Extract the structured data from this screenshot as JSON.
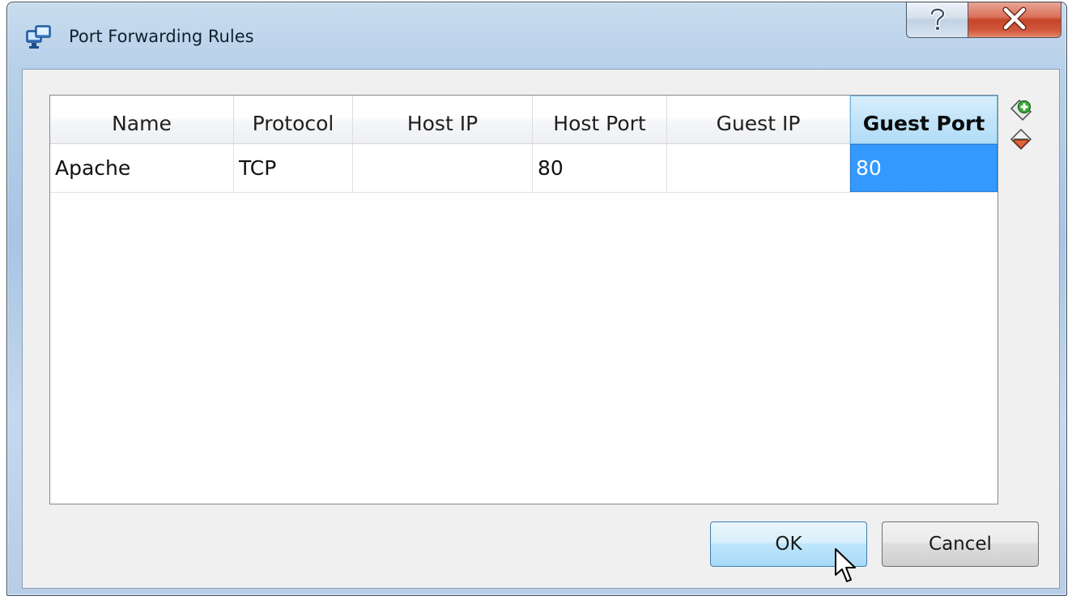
{
  "window": {
    "title": "Port Forwarding Rules",
    "help_glyph": "?",
    "close_glyph": "X"
  },
  "table": {
    "columns": [
      "Name",
      "Protocol",
      "Host IP",
      "Host Port",
      "Guest IP",
      "Guest Port"
    ],
    "active_column": "Guest Port",
    "rows": [
      {
        "name": "Apache",
        "protocol": "TCP",
        "host_ip": "",
        "host_port": "80",
        "guest_ip": "",
        "guest_port": "80"
      }
    ],
    "selected_cell": "guest_port"
  },
  "side_tools": {
    "add_icon": "add-rule-icon",
    "remove_icon": "remove-rule-icon"
  },
  "buttons": {
    "ok_label": "OK",
    "cancel_label": "Cancel"
  },
  "colors": {
    "selection": "#3399ff",
    "close_button": "#c64529",
    "active_header": "#c3e4f9"
  }
}
